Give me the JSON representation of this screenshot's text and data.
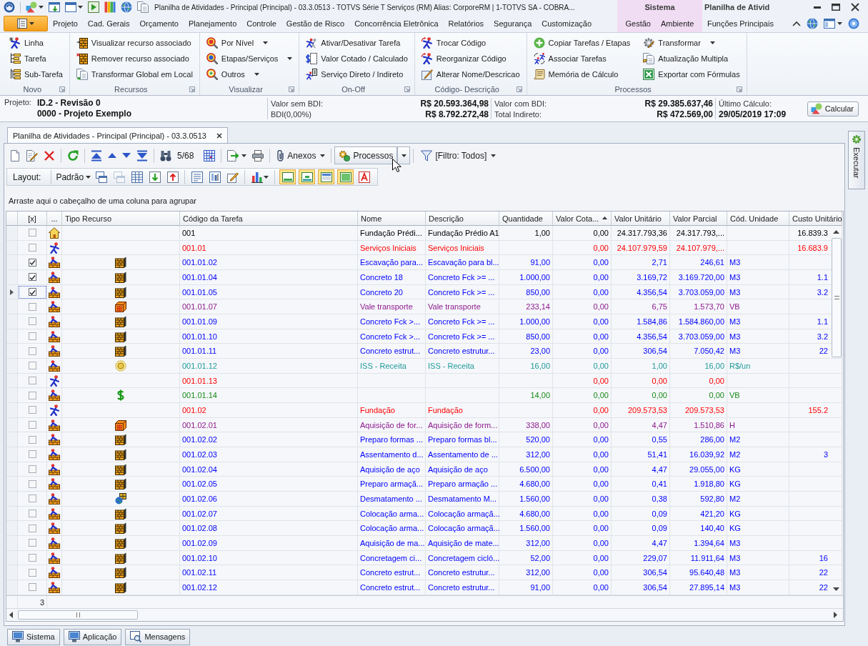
{
  "title_bar": {
    "title": "Planilha de Atividades - Principal (Principal) - 03.3.0513 - TOTVS Série T Serviços (RM) Alias: CorporeRM | 1-TOTVS SA - COBRA..."
  },
  "ribbon_tabs": [
    "Projeto",
    "Cad. Gerais",
    "Orçamento",
    "Planejamento",
    "Controle",
    "Gestão de Risco",
    "Concorrência Eletrônica",
    "Relatórios",
    "Segurança",
    "Customização"
  ],
  "context_groups": [
    {
      "label": "Sistema",
      "color": "#f0dcf3",
      "tabs": [
        "Gestão",
        "Ambiente"
      ]
    },
    {
      "label": "Planilha de Ativid",
      "tabs": [
        "Funções Principais"
      ]
    }
  ],
  "ribbon_groups": [
    {
      "label": "Novo",
      "columns": [
        [
          {
            "label": "Linha",
            "dropdown": false
          },
          {
            "label": "Tarefa",
            "dropdown": false
          },
          {
            "label": "Sub-Tarefa",
            "dropdown": false
          }
        ]
      ]
    },
    {
      "label": "Recursos",
      "columns": [
        [
          {
            "label": "Visualizar recurso associado",
            "dropdown": false
          },
          {
            "label": "Remover recurso associado",
            "dropdown": false
          },
          {
            "label": "Transformar Global em Local",
            "dropdown": false
          }
        ]
      ]
    },
    {
      "label": "Visualizar",
      "columns": [
        [
          {
            "label": "Por Nível",
            "dropdown": true
          },
          {
            "label": "Etapas/Serviços",
            "dropdown": true
          },
          {
            "label": "Outros",
            "dropdown": true
          }
        ]
      ]
    },
    {
      "label": "On-Off",
      "columns": [
        [
          {
            "label": "Ativar/Desativar Tarefa",
            "dropdown": false
          },
          {
            "label": "Valor Cotado / Calculado",
            "dropdown": false
          },
          {
            "label": "Serviço Direto / Indireto",
            "dropdown": false
          }
        ]
      ]
    },
    {
      "label": "Código- Descrição",
      "columns": [
        [
          {
            "label": "Trocar Código",
            "dropdown": false
          },
          {
            "label": "Reorganizar Código",
            "dropdown": false
          },
          {
            "label": "Alterar Nome/Descricao",
            "dropdown": false
          }
        ]
      ]
    },
    {
      "label": "Processos",
      "columns": [
        [
          {
            "label": "Copiar Tarefas / Etapas",
            "dropdown": false
          },
          {
            "label": "Associar Tarefas",
            "dropdown": false
          },
          {
            "label": "Memória de Cálculo",
            "dropdown": false
          }
        ],
        [
          {
            "label": "Transformar",
            "dropdown": true
          },
          {
            "label": "Atualização Multipla",
            "dropdown": false
          },
          {
            "label": "Exportar com Fórmulas",
            "dropdown": false
          }
        ]
      ]
    }
  ],
  "project_bar": {
    "project_label": "Projeto:",
    "project_lines": [
      "ID.2 - Revisão 0",
      "0000 - Projeto Exemplo"
    ],
    "figures": [
      [
        {
          "label": "Valor sem BDI:",
          "value": "R$ 20.593.364,98"
        },
        {
          "label": "BDI(0,00%)",
          "value": "R$ 8.792.272,48"
        }
      ],
      [
        {
          "label": "Valor com BDI:",
          "value": "R$ 29.385.637,46"
        },
        {
          "label": "Total Indireto:",
          "value": "R$ 472.569,00"
        }
      ]
    ],
    "last_calc_label": "Último Cálculo:",
    "last_calc": "29/05/2019 17:09",
    "calc_button": "Calcular"
  },
  "document_tab": {
    "title": "Planilha de Atividades - Principal (Principal) - 03.3.0513"
  },
  "side_tab": {
    "label": "Executar"
  },
  "toolbar": {
    "record_position": "5/68",
    "attachments": "Anexos",
    "processes": {
      "label": "Processos",
      "hovered": true
    },
    "filter": "[Filtro: Todos]"
  },
  "layout_bar": {
    "label": "Layout:",
    "layout": "Padrão",
    "tools": [
      {
        "disabled": false
      },
      {
        "disabled": true
      },
      {
        "disabled": false
      },
      {
        "disabled": false
      },
      {
        "disabled": false
      }
    ],
    "panels": [
      {
        "on": true
      },
      {
        "on": true
      },
      {
        "on": true
      },
      {
        "on": true
      }
    ]
  },
  "group_panel": {
    "hint": "Arraste aqui o cabeçalho de uma coluna para agrupar"
  },
  "table": {
    "columns": [
      {
        "label": "[x]",
        "sorted": false
      },
      {
        "label": "...",
        "sorted": false
      },
      {
        "label": "Tipo Recurso",
        "sorted": false
      },
      {
        "label": "Código da Tarefa",
        "sorted": false
      },
      {
        "label": "Nome",
        "sorted": false
      },
      {
        "label": "Descrição",
        "sorted": false
      },
      {
        "label": "Quantidade",
        "sorted": false
      },
      {
        "label": "Valor Cota...",
        "sorted": true
      },
      {
        "label": "Valor Unitário",
        "sorted": false
      },
      {
        "label": "Valor Parcial",
        "sorted": false
      },
      {
        "label": "Cód. Unidade",
        "sorted": false
      },
      {
        "label": "Custo Unitário",
        "sorted": false
      }
    ],
    "rows": [
      {
        "selected": false,
        "checked": false,
        "kind": "projeto",
        "code": "001",
        "name": "Fundação Prédi...",
        "description": "Fundação Prédio A1",
        "quantity": "1,00",
        "quoted_value": "0,00",
        "unit_value": "24.317.793,36",
        "partial_value": "24.317.793,...",
        "unit_cost": "16.839.3",
        "color": "#000000"
      },
      {
        "selected": false,
        "checked": false,
        "kind": "etapa",
        "code": "001.01",
        "name": "Serviços Iniciais",
        "description": "Serviços Iniciais",
        "quoted_value": "0,00",
        "unit_value": "24.107.979,59",
        "partial_value": "24.107.979,...",
        "unit_cost": "16.683.9",
        "color": "#ff0000"
      },
      {
        "selected": false,
        "checked": true,
        "kind": "servico",
        "resource": {
          "kind": "composicao"
        },
        "code": "001.01.02",
        "name": "Escavação para...",
        "description": "Escavação para bl...",
        "quantity": "91,00",
        "quoted_value": "0,00",
        "unit_value": "2,71",
        "partial_value": "246,61",
        "unit": "M3",
        "color": "#0000ff"
      },
      {
        "selected": false,
        "checked": true,
        "kind": "servico",
        "resource": {
          "kind": "composicao"
        },
        "code": "001.01.04",
        "name": "Concreto 18",
        "description": "Concreto Fck >= ...",
        "quantity": "1.000,00",
        "quoted_value": "0,00",
        "unit_value": "3.169,72",
        "partial_value": "3.169.720,00",
        "unit": "M3",
        "unit_cost": "1.1",
        "color": "#0000ff"
      },
      {
        "selected": true,
        "checked": true,
        "kind": "servico",
        "resource": {
          "kind": "composicao"
        },
        "code": "001.01.05",
        "name": "Concreto 20",
        "description": "Concreto Fck >= ...",
        "quantity": "850,00",
        "quoted_value": "0,00",
        "unit_value": "4.356,54",
        "partial_value": "3.703.059,00",
        "unit": "M3",
        "unit_cost": "3.2",
        "color": "#0000ff"
      },
      {
        "selected": false,
        "checked": false,
        "kind": "servico",
        "resource": {
          "kind": "insumo"
        },
        "code": "001.01.07",
        "name": "Vale transporte",
        "description": "Vale transporte",
        "quantity": "233,14",
        "quoted_value": "0,00",
        "unit_value": "6,75",
        "partial_value": "1.573,70",
        "unit": "VB",
        "color": "#8e1a8e"
      },
      {
        "selected": false,
        "checked": false,
        "kind": "servico",
        "resource": {
          "kind": "composicao"
        },
        "code": "001.01.09",
        "name": "Concreto Fck >...",
        "description": "Concreto Fck >= ...",
        "quantity": "1.000,00",
        "quoted_value": "0,00",
        "unit_value": "1.584,86",
        "partial_value": "1.584.860,00",
        "unit": "M3",
        "unit_cost": "1.1",
        "color": "#0000ff"
      },
      {
        "selected": false,
        "checked": false,
        "kind": "servico",
        "resource": {
          "kind": "composicao"
        },
        "code": "001.01.10",
        "name": "Concreto Fck >...",
        "description": "Concreto Fck >= ...",
        "quantity": "850,00",
        "quoted_value": "0,00",
        "unit_value": "4.356,54",
        "partial_value": "3.703.059,00",
        "unit": "M3",
        "unit_cost": "3.2",
        "color": "#0000ff"
      },
      {
        "selected": false,
        "checked": false,
        "kind": "servico",
        "resource": {
          "kind": "composicao"
        },
        "code": "001.01.11",
        "name": "Concreto estrut...",
        "description": "Concreto estrutur...",
        "quantity": "23,00",
        "quoted_value": "0,00",
        "unit_value": "306,54",
        "partial_value": "7.050,42",
        "unit": "M3",
        "unit_cost": "22",
        "color": "#0000ff"
      },
      {
        "selected": false,
        "checked": false,
        "kind": "servico",
        "resource": {
          "kind": "receita"
        },
        "code": "001.01.12",
        "name": "ISS - Receita",
        "description": "ISS - Receita",
        "quantity": "16,00",
        "quoted_value": "0,00",
        "unit_value": "1,00",
        "partial_value": "16,00",
        "unit": "R$/un",
        "color": "#1f9a9a"
      },
      {
        "selected": false,
        "checked": false,
        "kind": "etapa",
        "code": "001.01.13",
        "quoted_value": "0,00",
        "unit_value": "0,00",
        "partial_value": "0,00",
        "color": "#ff0000"
      },
      {
        "selected": false,
        "checked": false,
        "kind": "servico",
        "resource": {
          "kind": "verba"
        },
        "code": "001.01.14",
        "quantity": "14,00",
        "quoted_value": "0,00",
        "unit_value": "0,00",
        "partial_value": "0,00",
        "unit": "VB",
        "color": "#1a8a1a"
      },
      {
        "selected": false,
        "checked": false,
        "kind": "etapa",
        "code": "001.02",
        "name": "Fundação",
        "description": "Fundação",
        "quoted_value": "0,00",
        "unit_value": "209.573,53",
        "partial_value": "209.573,53",
        "unit_cost": "155.2",
        "color": "#ff0000"
      },
      {
        "selected": false,
        "checked": false,
        "kind": "servico",
        "resource": {
          "kind": "insumo"
        },
        "code": "001.02.01",
        "name": "Aquisição de for...",
        "description": "Aquisição de form...",
        "quantity": "338,00",
        "quoted_value": "0,00",
        "unit_value": "4,47",
        "partial_value": "1.510,86",
        "unit": "H",
        "color": "#8e1a8e"
      },
      {
        "selected": false,
        "checked": false,
        "kind": "servico",
        "resource": {
          "kind": "composicao"
        },
        "code": "001.02.02",
        "name": "Preparo formas ...",
        "description": "Preparo formas bl...",
        "quantity": "520,00",
        "quoted_value": "0,00",
        "unit_value": "0,55",
        "partial_value": "286,00",
        "unit": "M2",
        "color": "#0000ff"
      },
      {
        "selected": false,
        "checked": false,
        "kind": "servico",
        "resource": {
          "kind": "composicao"
        },
        "code": "001.02.03",
        "name": "Assentamento d...",
        "description": "Assentamento de ...",
        "quantity": "312,00",
        "quoted_value": "0,00",
        "unit_value": "51,41",
        "partial_value": "16.039,92",
        "unit": "M2",
        "unit_cost": "3",
        "color": "#0000ff"
      },
      {
        "selected": false,
        "checked": false,
        "kind": "servico",
        "resource": {
          "kind": "composicao"
        },
        "code": "001.02.04",
        "name": "Aquisição de aço",
        "description": "Aquisição de aço",
        "quantity": "6.500,00",
        "quoted_value": "0,00",
        "unit_value": "4,47",
        "partial_value": "29.055,00",
        "unit": "KG",
        "color": "#0000ff"
      },
      {
        "selected": false,
        "checked": false,
        "kind": "servico",
        "resource": {
          "kind": "composicao"
        },
        "code": "001.02.05",
        "name": "Preparo armaçã...",
        "description": "Preparo armação ...",
        "quantity": "4.680,00",
        "quoted_value": "0,00",
        "unit_value": "0,41",
        "partial_value": "1.918,80",
        "unit": "KG",
        "color": "#0000ff"
      },
      {
        "selected": false,
        "checked": false,
        "kind": "servico",
        "resource": {
          "kind": "equipamento"
        },
        "code": "001.02.06",
        "name": "Desmatamento ...",
        "description": "Desmatamento M...",
        "quantity": "1.560,00",
        "quoted_value": "0,00",
        "unit_value": "0,38",
        "partial_value": "592,80",
        "unit": "M2",
        "color": "#0000ff"
      },
      {
        "selected": false,
        "checked": false,
        "kind": "servico",
        "resource": {
          "kind": "composicao"
        },
        "code": "001.02.07",
        "name": "Colocação arma...",
        "description": "Colocação armaçã...",
        "quantity": "4.680,00",
        "quoted_value": "0,00",
        "unit_value": "0,09",
        "partial_value": "421,20",
        "unit": "KG",
        "color": "#0000ff"
      },
      {
        "selected": false,
        "checked": false,
        "kind": "servico",
        "resource": {
          "kind": "composicao"
        },
        "code": "001.02.08",
        "name": "Colocação arma...",
        "description": "Colocação armaçã...",
        "quantity": "1.560,00",
        "quoted_value": "0,00",
        "unit_value": "0,09",
        "partial_value": "140,40",
        "unit": "KG",
        "color": "#0000ff"
      },
      {
        "selected": false,
        "checked": false,
        "kind": "servico",
        "resource": {
          "kind": "composicao"
        },
        "code": "001.02.09",
        "name": "Aquisição de ma...",
        "description": "Aquisição de mate...",
        "quantity": "312,00",
        "quoted_value": "0,00",
        "unit_value": "4,47",
        "partial_value": "1.394,64",
        "unit": "M3",
        "color": "#0000ff"
      },
      {
        "selected": false,
        "checked": false,
        "kind": "servico",
        "resource": {
          "kind": "composicao"
        },
        "code": "001.02.10",
        "name": "Concretagem ci...",
        "description": "Concretagem cicló...",
        "quantity": "52,00",
        "quoted_value": "0,00",
        "unit_value": "229,07",
        "partial_value": "11.911,64",
        "unit": "M3",
        "unit_cost": "16",
        "color": "#0000ff"
      },
      {
        "selected": false,
        "checked": false,
        "kind": "servico",
        "resource": {
          "kind": "composicao"
        },
        "code": "001.02.11",
        "name": "Concreto estrut...",
        "description": "Concreto estrutur...",
        "quantity": "312,00",
        "quoted_value": "0,00",
        "unit_value": "306,54",
        "partial_value": "95.640,48",
        "unit": "M3",
        "unit_cost": "22",
        "color": "#0000ff"
      },
      {
        "selected": false,
        "checked": false,
        "kind": "servico",
        "resource": {
          "kind": "composicao"
        },
        "code": "001.02.12",
        "name": "Concreto estrut...",
        "description": "Concreto estrutur...",
        "quantity": "91,00",
        "quoted_value": "0,00",
        "unit_value": "306,54",
        "partial_value": "27.895,14",
        "unit": "M3",
        "unit_cost": "22",
        "color": "#0000ff"
      }
    ],
    "footer": {
      "count": "3"
    }
  },
  "bottom_tabs": [
    {
      "label": "Sistema"
    },
    {
      "label": "Aplicação"
    },
    {
      "label": "Mensagens"
    }
  ]
}
